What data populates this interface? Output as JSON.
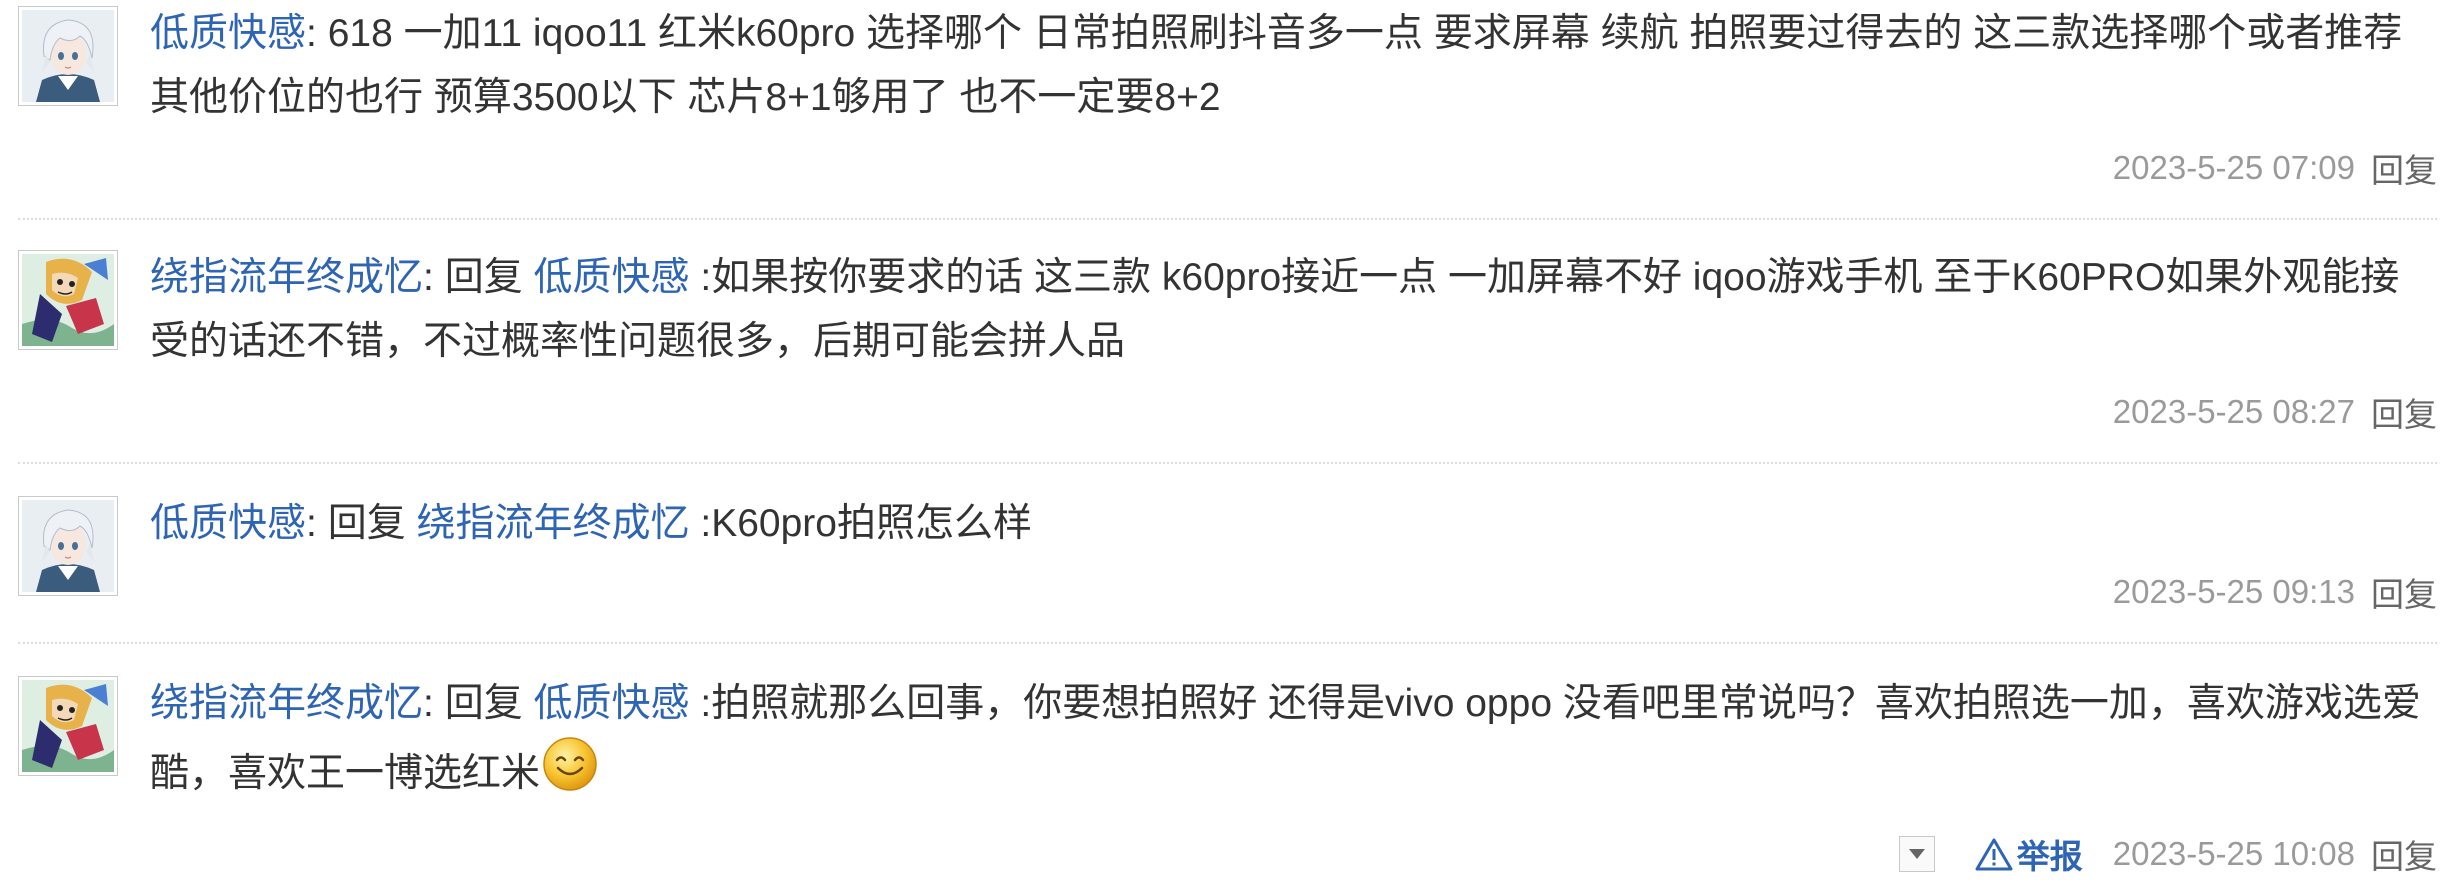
{
  "replies": [
    {
      "username": "低质快感",
      "colon": ":",
      "reply_prefix": "",
      "reply_target": "",
      "text": " 618 一加11 iqoo11 红米k60pro 选择哪个 日常拍照刷抖音多一点 要求屏幕 续航 拍照要过得去的 这三款选择哪个或者推荐其他价位的也行 预算3500以下 芯片8+1够用了 也不一定要8+2",
      "time": "2023-5-25 07:09",
      "reply_label": "回复"
    },
    {
      "username": "绕指流年终成忆",
      "colon": ":",
      "reply_prefix": " 回复 ",
      "reply_target": "低质快感",
      "text": " :如果按你要求的话 这三款 k60pro接近一点 一加屏幕不好 iqoo游戏手机 至于K60PRO如果外观能接受的话还不错，不过概率性问题很多，后期可能会拼人品",
      "time": "2023-5-25 08:27",
      "reply_label": "回复"
    },
    {
      "username": "低质快感",
      "colon": ":",
      "reply_prefix": " 回复 ",
      "reply_target": "绕指流年终成忆",
      "text": " :K60pro拍照怎么样",
      "time": "2023-5-25 09:13",
      "reply_label": "回复"
    },
    {
      "username": "绕指流年终成忆",
      "colon": ":",
      "reply_prefix": " 回复 ",
      "reply_target": "低质快感",
      "text": " :拍照就那么回事，你要想拍照好 还得是vivo oppo 没看吧里常说吗？喜欢拍照选一加，喜欢游戏选爱酷，喜欢王一博选红米",
      "emoji": "smile-emoji",
      "time": "2023-5-25 10:08",
      "report_label": "举报",
      "reply_label": "回复"
    }
  ],
  "colors": {
    "link": "#2d64b3",
    "text": "#333333",
    "meta": "#999999"
  }
}
